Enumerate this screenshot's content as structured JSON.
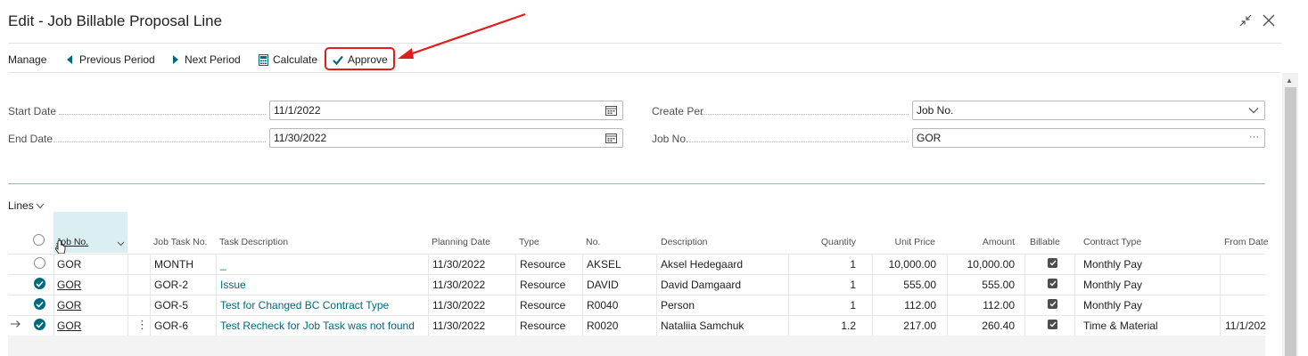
{
  "window": {
    "title": "Edit - Job Billable Proposal Line",
    "collapse_icon": "collapse-icon",
    "close_icon": "close-icon"
  },
  "actions": {
    "manage": "Manage",
    "previous_period": "Previous Period",
    "next_period": "Next Period",
    "calculate": "Calculate",
    "approve": "Approve"
  },
  "fields": {
    "start_date": {
      "label": "Start Date",
      "value": "11/1/2022"
    },
    "end_date": {
      "label": "End Date",
      "value": "11/30/2022"
    },
    "create_per": {
      "label": "Create Per",
      "value": "Job No."
    },
    "job_no": {
      "label": "Job No.",
      "value": "GOR",
      "lookup": "···"
    }
  },
  "lines": {
    "label": "Lines",
    "columns": {
      "job_no": "Job No.",
      "job_task_no": "Job Task No.",
      "task_description": "Task Description",
      "planning_date": "Planning Date",
      "type": "Type",
      "no": "No.",
      "description": "Description",
      "quantity": "Quantity",
      "unit_price": "Unit Price",
      "amount": "Amount",
      "billable": "Billable",
      "contract_type": "Contract Type",
      "from_date": "From Date"
    },
    "rows": [
      {
        "selected": false,
        "current": false,
        "job_no": "GOR",
        "job_task_no": "MONTH",
        "task_description": "_",
        "planning_date": "11/30/2022",
        "type": "Resource",
        "no": "AKSEL",
        "description": "Aksel Hedegaard",
        "quantity": "1",
        "unit_price": "10,000.00",
        "amount": "10,000.00",
        "billable": true,
        "contract_type": "Monthly Pay",
        "from_date": ""
      },
      {
        "selected": true,
        "current": false,
        "job_no": "GOR",
        "job_task_no": "GOR-2",
        "task_description": "Issue",
        "planning_date": "11/30/2022",
        "type": "Resource",
        "no": "DAVID",
        "description": "David Damgaard",
        "quantity": "1",
        "unit_price": "555.00",
        "amount": "555.00",
        "billable": true,
        "contract_type": "Monthly Pay",
        "from_date": ""
      },
      {
        "selected": true,
        "current": false,
        "job_no": "GOR",
        "job_task_no": "GOR-5",
        "task_description": "Test for Changed BC Contract Type",
        "planning_date": "11/30/2022",
        "type": "Resource",
        "no": "R0040",
        "description": "Person",
        "quantity": "1",
        "unit_price": "112.00",
        "amount": "112.00",
        "billable": true,
        "contract_type": "Monthly Pay",
        "from_date": ""
      },
      {
        "selected": true,
        "current": true,
        "job_no": "GOR",
        "job_task_no": "GOR-6",
        "task_description": "Test Recheck for Job Task was not found",
        "planning_date": "11/30/2022",
        "type": "Resource",
        "no": "R0020",
        "description": "Nataliia Samchuk",
        "quantity": "1.2",
        "unit_price": "217.00",
        "amount": "260.40",
        "billable": true,
        "contract_type": "Time & Material",
        "from_date": "11/1/202"
      }
    ]
  },
  "colors": {
    "accent": "#00697c",
    "annotation_red": "#e21b1b"
  }
}
